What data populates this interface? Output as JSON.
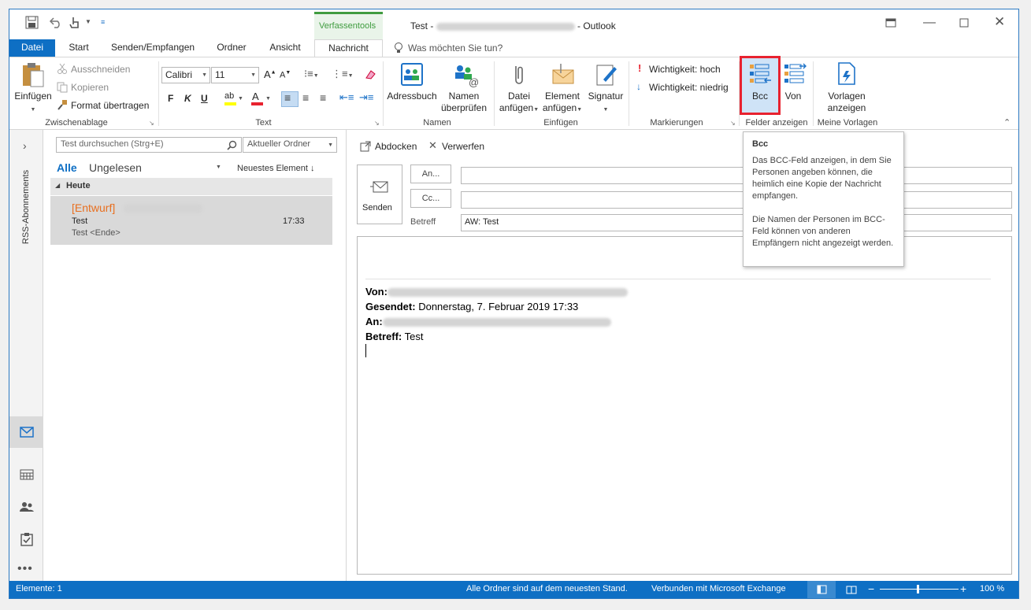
{
  "title": {
    "prefix": "Test - ",
    "suffix": " - Outlook"
  },
  "context_tab": "Verfassentools",
  "tabs": [
    "Datei",
    "Start",
    "Senden/Empfangen",
    "Ordner",
    "Ansicht",
    "Nachricht"
  ],
  "tell_me": "Was möchten Sie tun?",
  "ribbon": {
    "clipboard": {
      "paste": "Einfügen",
      "cut": "Ausschneiden",
      "copy": "Kopieren",
      "format_painter": "Format übertragen",
      "group": "Zwischenablage"
    },
    "text": {
      "font": "Calibri",
      "size": "11",
      "bold": "F",
      "italic": "K",
      "underline": "U",
      "group": "Text"
    },
    "names": {
      "address_book": "Adressbuch",
      "check_names_1": "Namen",
      "check_names_2": "überprüfen",
      "group": "Namen"
    },
    "insert": {
      "attach_file_1": "Datei",
      "attach_file_2": "anfügen",
      "attach_item_1": "Element",
      "attach_item_2": "anfügen",
      "signature": "Signatur",
      "group": "Einfügen"
    },
    "tags": {
      "high": "Wichtigkeit: hoch",
      "low": "Wichtigkeit: niedrig",
      "group": "Markierungen"
    },
    "fields": {
      "bcc": "Bcc",
      "from": "Von",
      "group": "Felder anzeigen"
    },
    "templates": {
      "view_1": "Vorlagen",
      "view_2": "anzeigen",
      "group": "Meine Vorlagen"
    }
  },
  "tooltip": {
    "title": "Bcc",
    "p1": "Das BCC-Feld anzeigen, in dem Sie Personen angeben können, die heimlich eine Kopie der Nachricht empfangen.",
    "p2": "Die Namen der Personen im BCC-Feld können von anderen Empfängern nicht angezeigt werden."
  },
  "nav": {
    "rss": "RSS-Abonnements"
  },
  "list": {
    "search_placeholder": "Test durchsuchen (Strg+E)",
    "scope": "Aktueller Ordner",
    "filter_all": "Alle",
    "filter_unread": "Ungelesen",
    "sort": "Neuestes Element",
    "group_today": "Heute",
    "item": {
      "draft": "[Entwurf]",
      "subject": "Test",
      "time": "17:33",
      "preview": "Test <Ende>"
    }
  },
  "compose": {
    "popout": "Abdocken",
    "discard": "Verwerfen",
    "send": "Senden",
    "to_btn": "An...",
    "cc_btn": "Cc...",
    "subject_label": "Betreff",
    "subject_value": "AW: Test",
    "header": {
      "from_label": "Von:",
      "sent_label": "Gesendet:",
      "sent_value": "Donnerstag, 7. Februar 2019 17:33",
      "to_label": "An:",
      "subject_label": "Betreff:",
      "subject_value": "Test"
    }
  },
  "status": {
    "items": "Elemente: 1",
    "sync": "Alle Ordner sind auf dem neuesten Stand.",
    "connection": "Verbunden mit Microsoft Exchange",
    "zoom": "100 %"
  },
  "colors": {
    "accent": "#0e6fc4",
    "draft": "#e86f1f",
    "highlight": "#e8222f",
    "context": "#3f9c3f"
  }
}
